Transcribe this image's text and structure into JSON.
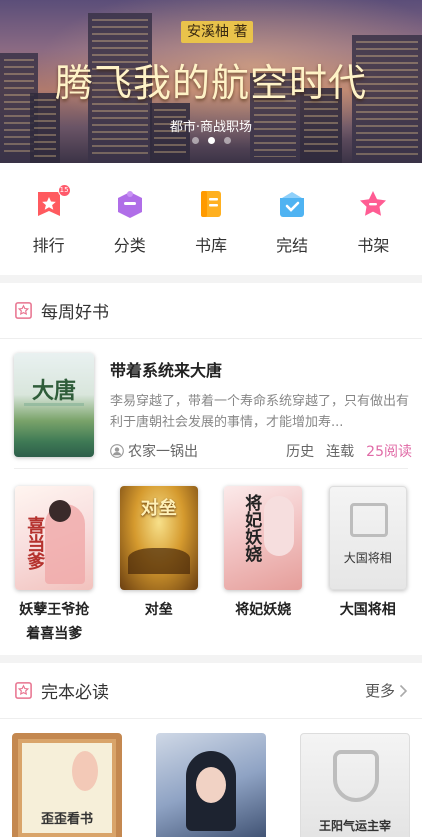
{
  "banner": {
    "author_tag": "安溪柚 著",
    "title": "腾飞我的航空时代",
    "subtitle": "都市·商战职场",
    "active_dot": 1,
    "dot_count": 3
  },
  "nav": [
    {
      "label": "排行",
      "icon": "ranking-icon",
      "badge": "15"
    },
    {
      "label": "分类",
      "icon": "category-icon"
    },
    {
      "label": "书库",
      "icon": "library-icon"
    },
    {
      "label": "完结",
      "icon": "finished-icon"
    },
    {
      "label": "书架",
      "icon": "bookshelf-icon"
    }
  ],
  "weekly": {
    "title": "每周好书",
    "featured": {
      "cover_text": "大唐",
      "title": "带着系统来大唐",
      "description": "李易穿越了，带着一个寿命系统穿越了，只有做出有利于唐朝社会发展的事情，才能增加寿...",
      "author": "农家一锅出",
      "category": "历史",
      "status": "连载",
      "reads": "25阅读"
    },
    "books": [
      {
        "title": "妖孽王爷抢着喜当爹",
        "cover_text": "喜当爹"
      },
      {
        "title": "对垒",
        "cover_text": "对垒"
      },
      {
        "title": "将妃妖娆",
        "cover_text": "将妃妖娆"
      },
      {
        "title": "大国将相",
        "cover_text": "大国将相"
      }
    ]
  },
  "complete": {
    "title": "完本必读",
    "more_label": "更多",
    "books": [
      {
        "cover_text": "歪歪看书"
      },
      {
        "cover_text": ""
      },
      {
        "cover_text": "王阳气运主宰"
      }
    ]
  },
  "colors": {
    "accent": "#e06aa6",
    "tag_yellow": "#e9c34b",
    "section_icon": "#e8738f"
  }
}
